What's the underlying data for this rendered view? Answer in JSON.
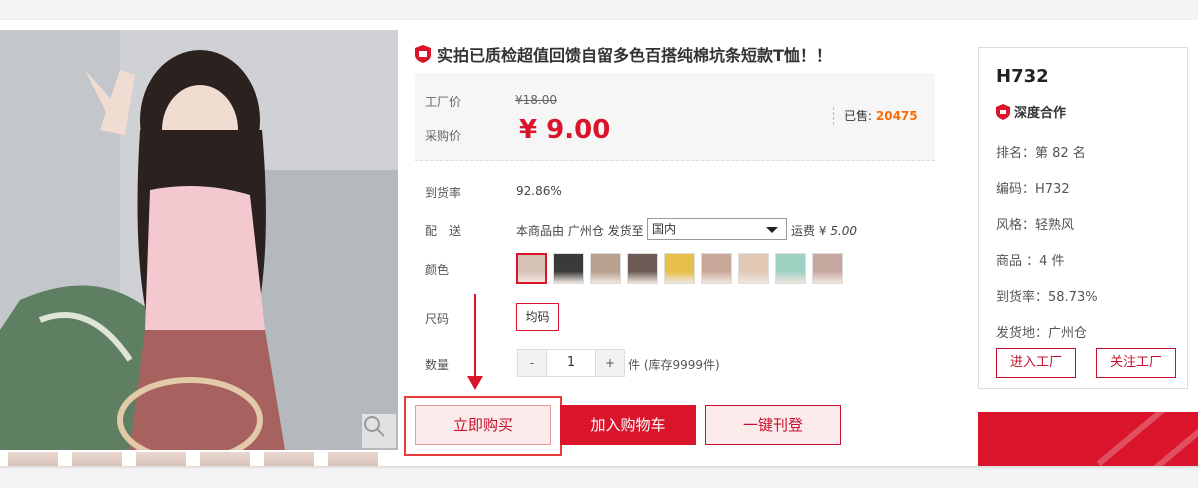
{
  "product": {
    "title": "实拍已质检超值回馈自留多色百搭纯棉坑条短款T恤！！",
    "badge_icon": "shield-badge-icon"
  },
  "price": {
    "factory_label": "工厂价",
    "factory_value": "¥18.00",
    "buy_label": "采购价",
    "buy_value": "¥ 9.00",
    "sold_label": "已售:",
    "sold_value": "20475"
  },
  "rows": {
    "arrival_label": "到货率",
    "arrival_value": "92.86%",
    "delivery_label": "配　送",
    "delivery_text": "本商品由 广州仓 发货至",
    "delivery_select": "国内",
    "fee_label": "运费 ¥",
    "fee_value": "5.00",
    "color_label": "颜色",
    "size_label": "尺码",
    "size_option": "均码",
    "qty_label": "数量",
    "qty_minus": "-",
    "qty_value": "1",
    "qty_plus": "+",
    "stock_text": "件 (库存9999件)"
  },
  "swatch_colors": [
    "#d7c2b8",
    "#3a3a3a",
    "#b8a08e",
    "#6b5a55",
    "#e6c04a",
    "#c9a89a",
    "#e1c9b5",
    "#9fd1c2",
    "#c6a8a0"
  ],
  "actions": {
    "buy_now": "立即购买",
    "add_cart": "加入购物车",
    "one_click": "一键刊登"
  },
  "shop": {
    "name": "H732",
    "deep_label": "深度合作",
    "rank": "排名：第 82 名",
    "code": "编码：H732",
    "style": "风格：轻熟风",
    "goods": "商品 ：4 件",
    "arrival": "到货率：58.73%",
    "ship_from": "发货地：广州仓",
    "enter_btn": "进入工厂",
    "follow_btn": "关注工厂"
  },
  "colors": {
    "accent": "#d9142b",
    "sold_highlight": "#ff6a00"
  }
}
